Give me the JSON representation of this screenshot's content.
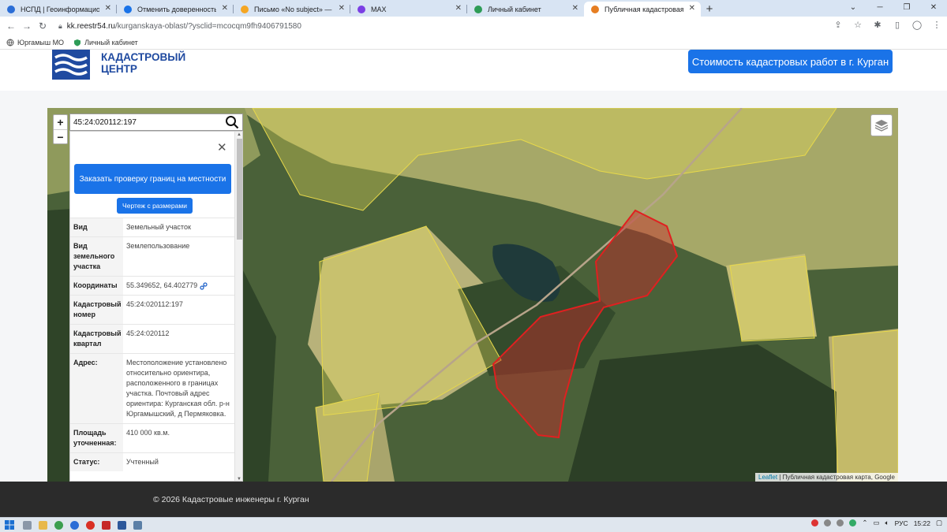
{
  "browser": {
    "tabs": [
      {
        "label": "НСПД | Геоинформационный п",
        "favicon_color": "#2a6dd6",
        "active": false
      },
      {
        "label": "Отменить доверенность",
        "favicon_color": "#1a73e8",
        "active": false
      },
      {
        "label": "Письмо «No subject» — Натал",
        "favicon_color": "#f5a623",
        "active": false
      },
      {
        "label": "MAX",
        "favicon_color": "#7b3fe4",
        "active": false
      },
      {
        "label": "Личный кабинет",
        "favicon_color": "#2e9c57",
        "active": false
      },
      {
        "label": "Публичная кадастровая карта",
        "favicon_color": "#e67e22",
        "active": true
      }
    ],
    "url_domain": "kk.reestr54.ru",
    "url_path": "/kurganskaya-oblast/?ysclid=mcocqm9fh9406791580",
    "bookmarks": [
      {
        "label": "Юргамыш МО",
        "icon": "globe-icon"
      },
      {
        "label": "Личный кабинет",
        "icon": "shield-icon"
      }
    ]
  },
  "site": {
    "logo_text_line1": "КАДАСТРОВЫЙ",
    "logo_text_line2": "ЦЕНТР",
    "cta_label": "Стоимость кадастровых работ в г. Курган",
    "brand_color": "#1a73e8"
  },
  "map": {
    "zoom_in": "+",
    "zoom_out": "−",
    "search_value": "45:24:020112:197",
    "attribution_link": "Leaflet",
    "attribution_text": " | Публичная кадастровая карта, Google"
  },
  "panel": {
    "close": "✕",
    "order_button": "Заказать проверку границ на местности",
    "drawing_button": "Чертеж с размерами",
    "rows": [
      {
        "key": "Вид",
        "value": "Земельный участок"
      },
      {
        "key": "Вид земельного участка",
        "value": "Землепользование"
      },
      {
        "key": "Координаты",
        "value": "55.349652, 64.402779"
      },
      {
        "key": "Кадастровый номер",
        "value": "45:24:020112:197"
      },
      {
        "key": "Кадастровый квартал",
        "value": "45:24:020112"
      },
      {
        "key": "Адрес:",
        "value": "Местоположение установлено относительно ориентира, расположенного в границах участка. Почтовый адрес ориентира: Курганская обл. р-н Юргамышский, д Пермяковка."
      },
      {
        "key": "Площадь уточненная:",
        "value": "410 000 кв.м."
      },
      {
        "key": "Статус:",
        "value": "Учтенный"
      }
    ]
  },
  "footer": {
    "copyright": "© 2026 Кадастровые инженеры г. Курган"
  },
  "taskbar": {
    "lang": "РУС",
    "time": "15:22"
  }
}
